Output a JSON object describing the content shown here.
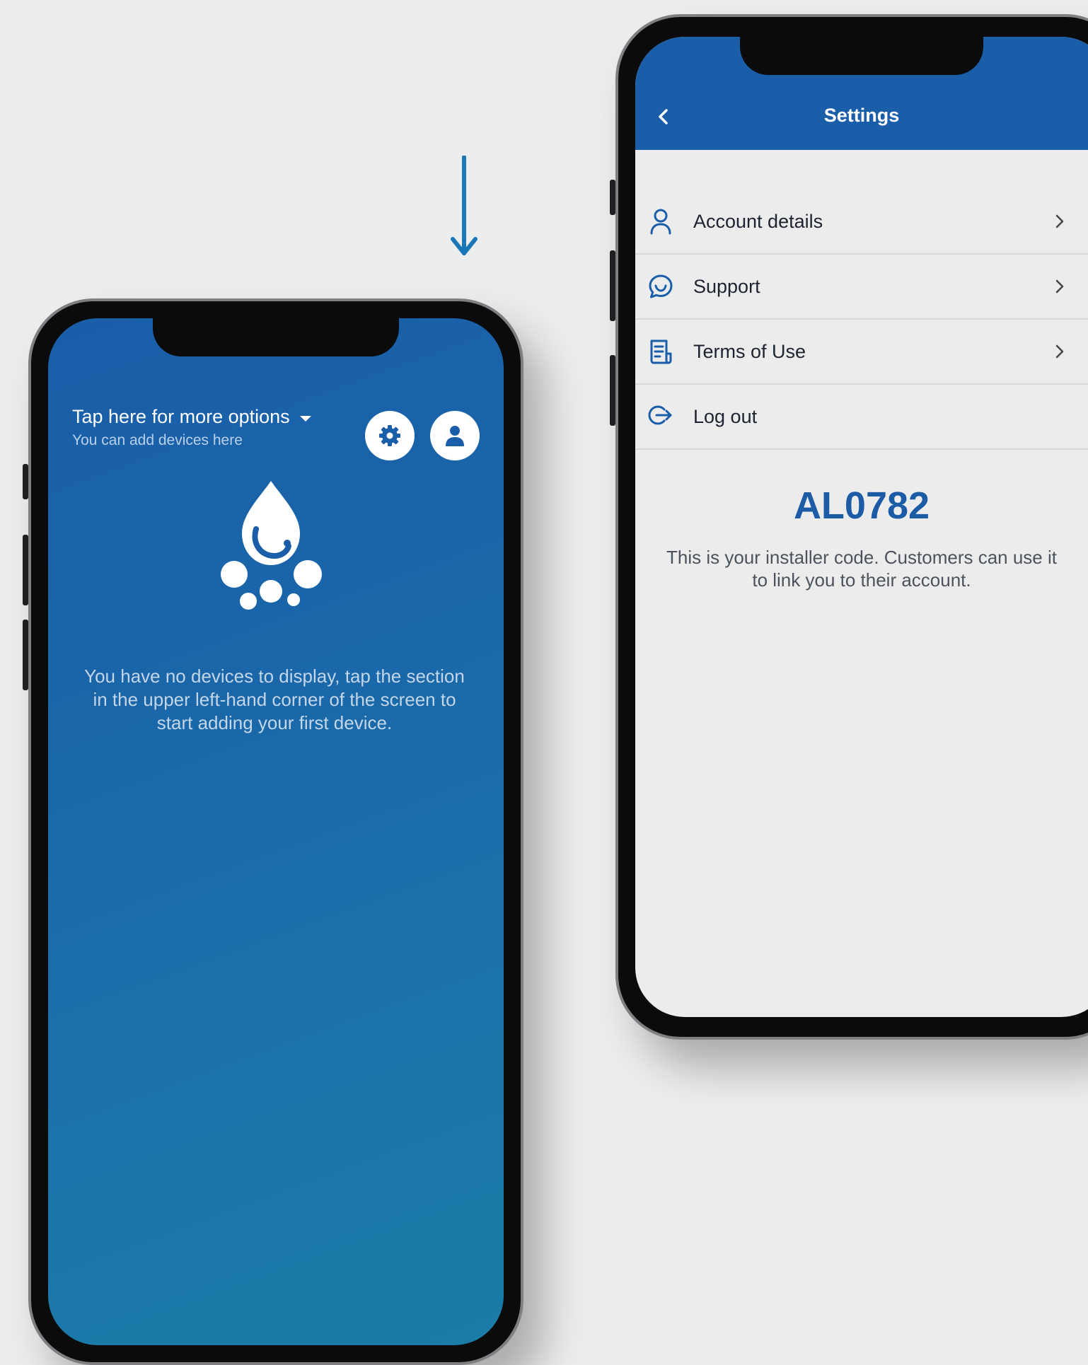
{
  "colors": {
    "accent_blue": "#1a5ea9",
    "installer_code": "#1c5ba6",
    "background": "#eceeee"
  },
  "home_screen": {
    "options_title": "Tap here for more options",
    "options_subtitle": "You can add devices here",
    "settings_icon": "gear-icon",
    "profile_icon": "user-icon",
    "logo_icon": "water-drop-icon",
    "empty_message": "You have no devices to display, tap the section in the upper left-hand corner of the screen to start adding your first device."
  },
  "settings_screen": {
    "title": "Settings",
    "back_icon": "chevron-left-icon",
    "menu": [
      {
        "label": "Account details",
        "icon": "user-icon",
        "chevron": true
      },
      {
        "label": "Support",
        "icon": "chat-icon",
        "chevron": true
      },
      {
        "label": "Terms of Use",
        "icon": "document-icon",
        "chevron": true
      },
      {
        "label": "Log out",
        "icon": "logout-icon",
        "chevron": false
      }
    ],
    "installer_code": "AL0782",
    "installer_description": "This is your installer code. Customers can use it to link you to their account."
  }
}
